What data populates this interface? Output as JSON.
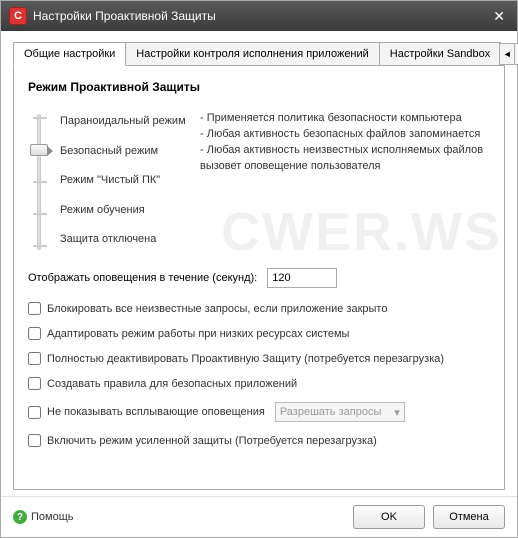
{
  "window": {
    "title": "Настройки Проактивной Защиты"
  },
  "tabs": {
    "t1": "Общие настройки",
    "t2": "Настройки контроля исполнения приложений",
    "t3": "Настройки Sandbox"
  },
  "section_title": "Режим Проактивной Защиты",
  "mode_labels": {
    "paranoid": "Параноидальный режим",
    "safe": "Безопасный режим",
    "clean": "Режим \"Чистый ПК\"",
    "learning": "Режим обучения",
    "off": "Защита отключена"
  },
  "mode_desc": {
    "l1": "- Применяется политика безопасности компьютера",
    "l2": "- Любая активность безопасных файлов запоминается",
    "l3": "- Любая активность неизвестных исполняемых файлов вызовет оповещение пользователя"
  },
  "timeout": {
    "label": "Отображать оповещения в течение (секунд):",
    "value": "120"
  },
  "checks": {
    "c1": "Блокировать все неизвестные запросы, если приложение закрыто",
    "c2": "Адаптировать режим работы при низких ресурсах системы",
    "c3": "Полностью деактивировать Проактивную Защиту (потребуется перезагрузка)",
    "c4": "Создавать правила для безопасных приложений",
    "c5": "Не показывать всплывающие оповещения",
    "c5_combo": "Разрешать запросы",
    "c6": "Включить режим усиленной защиты (Потребуется перезагрузка)"
  },
  "footer": {
    "help": "Помощь",
    "ok": "OK",
    "cancel": "Отмена"
  },
  "watermark": "CWER.WS"
}
